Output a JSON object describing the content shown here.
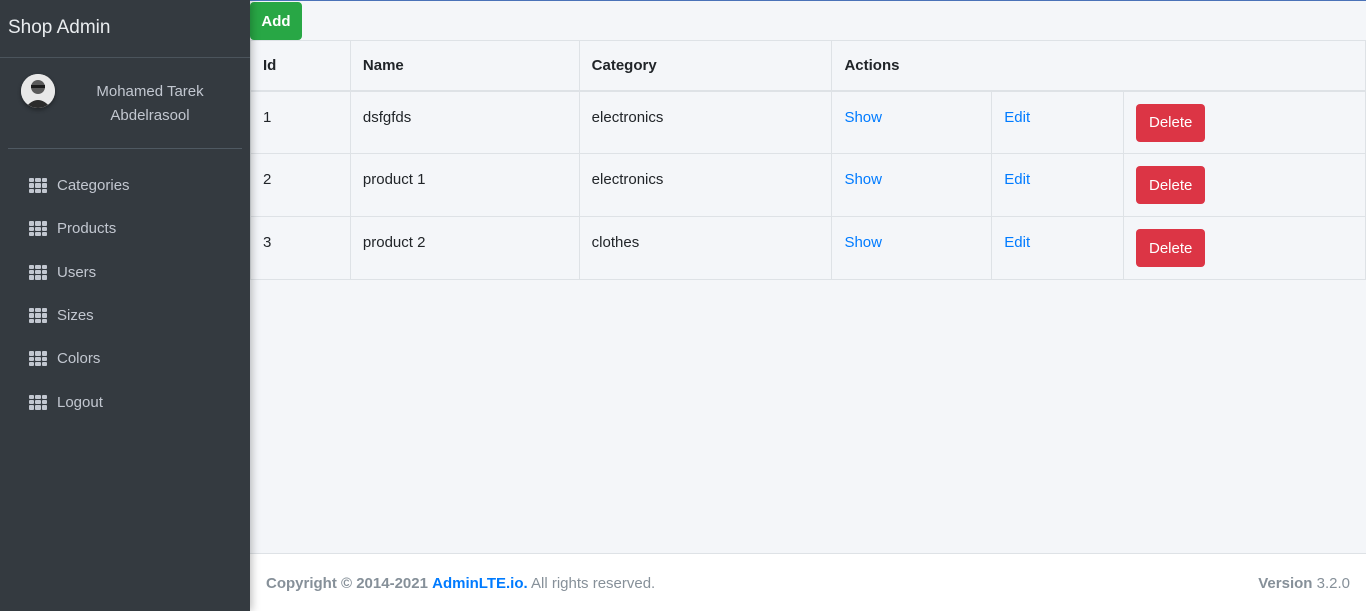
{
  "brand": {
    "title": "Shop Admin"
  },
  "user": {
    "name_line1": "Mohamed Tarek",
    "name_line2": "Abdelrasool"
  },
  "sidebar": {
    "items": [
      {
        "label": "Categories",
        "icon": "th-grid-icon"
      },
      {
        "label": "Products",
        "icon": "th-grid-icon"
      },
      {
        "label": "Users",
        "icon": "th-grid-icon"
      },
      {
        "label": "Sizes",
        "icon": "th-grid-icon"
      },
      {
        "label": "Colors",
        "icon": "th-grid-icon"
      },
      {
        "label": "Logout",
        "icon": "th-grid-icon"
      }
    ]
  },
  "toolbar": {
    "add_label": "Add"
  },
  "table": {
    "headers": [
      "Id",
      "Name",
      "Category",
      "Actions"
    ],
    "rows": [
      {
        "id": "1",
        "name": "dsfgfds",
        "category": "electronics",
        "show": "Show",
        "edit": "Edit",
        "delete": "Delete"
      },
      {
        "id": "2",
        "name": "product 1",
        "category": "electronics",
        "show": "Show",
        "edit": "Edit",
        "delete": "Delete"
      },
      {
        "id": "3",
        "name": "product 2",
        "category": "clothes",
        "show": "Show",
        "edit": "Edit",
        "delete": "Delete"
      }
    ]
  },
  "footer": {
    "copyright": "Copyright © 2014-2021",
    "brand_link": "AdminLTE.io.",
    "rights": "All rights reserved.",
    "version_label": "Version",
    "version_value": "3.2.0"
  },
  "colors": {
    "sidebar_bg": "#343a40",
    "primary": "#007bff",
    "success": "#28a745",
    "danger": "#dc3545"
  }
}
